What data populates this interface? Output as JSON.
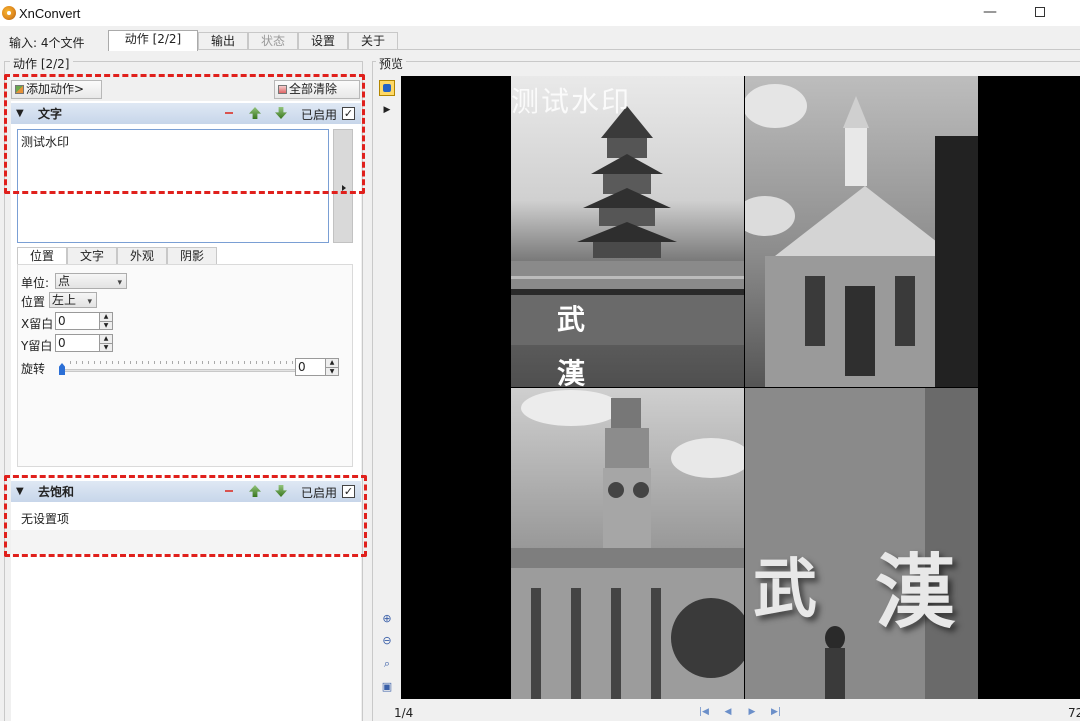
{
  "window": {
    "title": "XnConvert",
    "minimize": "—",
    "maximize": ""
  },
  "tabs": {
    "input_label": "输入: 4个文件",
    "items": [
      {
        "label": "动作 [2/2]"
      },
      {
        "label": "输出"
      },
      {
        "label": "状态"
      },
      {
        "label": "设置"
      },
      {
        "label": "关于"
      }
    ]
  },
  "actions_panel": {
    "caption": "动作 [2/2]",
    "add_action": "添加动作>",
    "clear_all": "全部清除",
    "enabled_label": "已启用",
    "checkbox_mark": "✓",
    "text_action": {
      "title": "文字",
      "text_value": "测试水印",
      "subtabs": [
        "位置",
        "文字",
        "外观",
        "阴影"
      ],
      "unit_label": "单位:",
      "unit_value": "点",
      "position_label": "位置",
      "position_value": "左上",
      "x_margin_label": "X留白",
      "x_margin_value": "0",
      "y_margin_label": "Y留白",
      "y_margin_value": "0",
      "rotate_label": "旋转",
      "rotate_value": "0"
    },
    "desaturate_action": {
      "title": "去饱和",
      "empty_text": "无设置项"
    }
  },
  "preview": {
    "caption": "预览",
    "watermark_text": "测试水印",
    "photo_text_1": "武",
    "photo_text_2": "漢",
    "wall_text_1": "武",
    "wall_text_2": "漢",
    "page_count": "1/4",
    "zoom_level": "72"
  },
  "colors": {
    "highlight": "#e0201c",
    "header": "#c7d6ea",
    "accent": "#2b6fd6"
  }
}
